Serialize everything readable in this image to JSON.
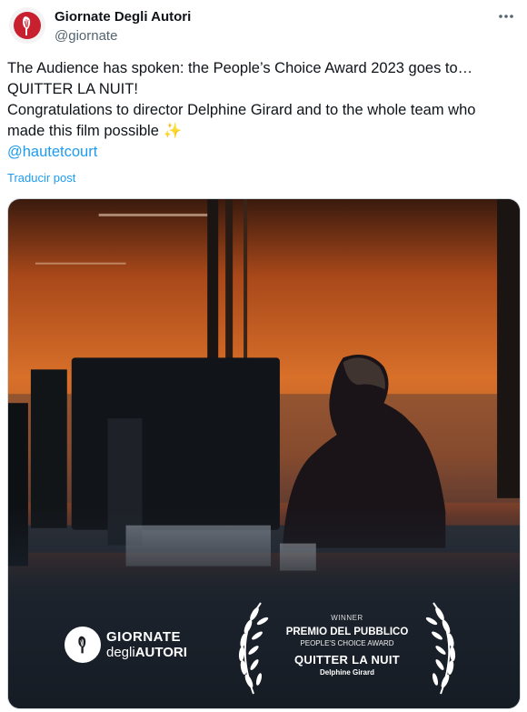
{
  "tweet": {
    "author": {
      "display_name": "Giornate Degli Autori",
      "handle": "@giornate",
      "avatar_icon": "giornate-logo-icon"
    },
    "more_icon": "more-horizontal-icon",
    "text_lines": [
      "The Audience has spoken: the People’s Choice Award 2023 goes to…",
      "QUITTER LA NUIT!",
      "Congratulations to director Delphine Girard and to the whole team who",
      "made this film possible"
    ],
    "sparkle_emoji": "✨",
    "mention": "@hautetcourt",
    "translate_label": "Traducir post"
  },
  "media": {
    "brand": {
      "line1": "GIORNATE",
      "line2_part1": "degli",
      "line2_part2": "AUTORI"
    },
    "award": {
      "winner": "WINNER",
      "premio": "PREMIO DEL PUBBLICO",
      "peoples_choice": "PEOPLE'S CHOICE AWARD",
      "film": "QUITTER LA NUIT",
      "director": "Delphine Girard"
    }
  },
  "colors": {
    "link": "#1d9bf0",
    "text": "#0f1419",
    "secondary": "#536471",
    "logo_red": "#c8202f"
  }
}
